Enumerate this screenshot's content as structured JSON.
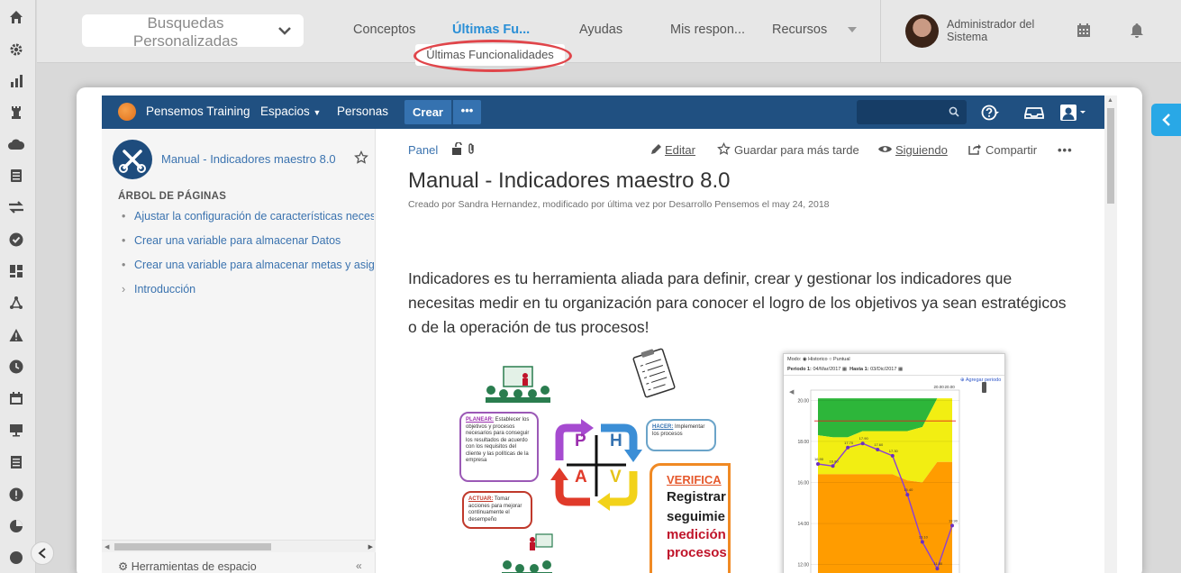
{
  "topbar": {
    "search_label": "Busquedas Personalizadas",
    "nav": [
      "Conceptos",
      "Últimas Fu...",
      "Ayudas",
      "Mis respon...",
      "Recursos"
    ],
    "dropdown_item": "Últimas Funcionalidades",
    "user_name": "Administrador del Sistema"
  },
  "confluence": {
    "brand": "Pensemos Training",
    "nav_spaces": "Espacios",
    "nav_people": "Personas",
    "create": "Crear",
    "more": "•••"
  },
  "sidebar": {
    "space_name": "Manual - Indicadores maestro 8.0",
    "tree_heading": "ÁRBOL DE PÁGINAS",
    "tree": [
      {
        "bullet": "•",
        "label": "Ajustar la configuración de características neces"
      },
      {
        "bullet": "•",
        "label": "Crear una variable para almacenar Datos"
      },
      {
        "bullet": "•",
        "label": "Crear una variable para almacenar metas y asig"
      },
      {
        "bullet": "›",
        "label": "Introducción"
      }
    ],
    "tools": "Herramientas de espacio"
  },
  "page": {
    "breadcrumb": "Panel",
    "actions": {
      "edit": "Editar",
      "save": "Guardar para más tarde",
      "watch": "Siguiendo",
      "share": "Compartir"
    },
    "title": "Manual - Indicadores maestro 8.0",
    "byline": "Creado por Sandra Hernandez, modificado por última vez por Desarrollo Pensemos el may 24, 2018",
    "intro": "Indicadores es tu herramienta aliada para definir, crear y gestionar los indicadores que necesitas medir en tu organización para conocer el logro de los objetivos ya sean estratégicos o de la operación de tus procesos!"
  },
  "phva": {
    "planear_title": "PLANEAR:",
    "planear_text": "Establecer los objetivos y procesos necesarios para conseguir los resultados de acuerdo con los requisitos del cliente y las políticas de la empresa",
    "hacer_title": "HACER:",
    "hacer_text": "Implementar los procesos",
    "actuar_title": "ACTUAR:",
    "actuar_text": "Tomar acciones para mejorar continuamente el desempeño",
    "verificar_title": "VERIFICA",
    "verificar_lines": [
      "Registrar",
      "seguimie"
    ],
    "verificar_red": [
      "medición",
      "procesos"
    ],
    "letters": {
      "p": "P",
      "h": "H",
      "a": "A",
      "v": "V"
    }
  },
  "chart_shot": {
    "mode_label": "Modo:",
    "mode_a": "Historico",
    "mode_b": "Puntual",
    "period_label": "Periodo 1:",
    "date_from": "04/Mar/2017",
    "until_label": "Hasta 1:",
    "date_to": "03/Dic/2017",
    "add_period": "Agregar periodo",
    "y_ticks": [
      "20.00",
      "18.00",
      "16.00",
      "14.00",
      "12.00"
    ],
    "top_labels": [
      "20.00",
      "20.00"
    ],
    "bands": [
      {
        "color": "#2db63a"
      },
      {
        "color": "#f2ee12"
      },
      {
        "color": "#ff9c00"
      }
    ]
  },
  "chart_data": {
    "type": "line",
    "title": "",
    "xlabel": "",
    "ylabel": "",
    "ylim": [
      11.5,
      20.5
    ],
    "series": [
      {
        "values": [
          16.9,
          16.8,
          17.7,
          17.9,
          17.6,
          17.3,
          15.4,
          13.1,
          11.8,
          13.9
        ]
      }
    ]
  }
}
